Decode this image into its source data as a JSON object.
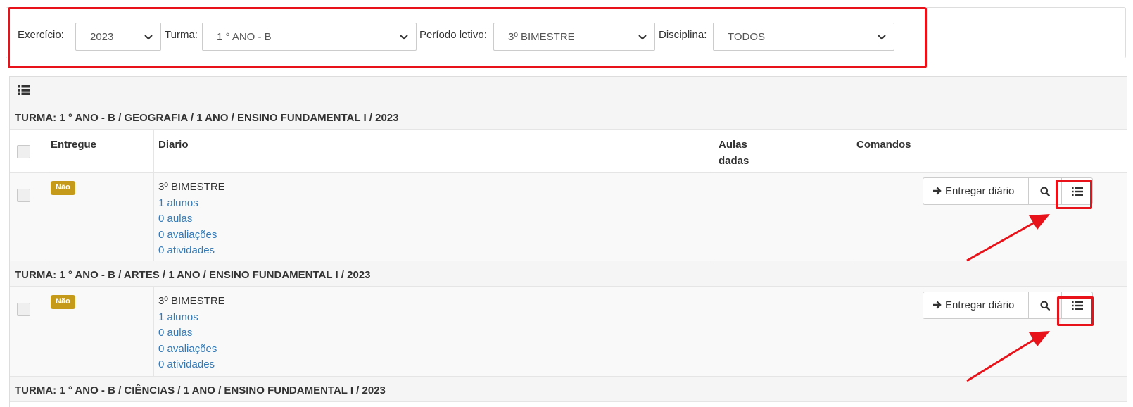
{
  "filters": {
    "exercicio": {
      "label": "Exercício:",
      "value": "2023"
    },
    "turma": {
      "label": "Turma:",
      "value": "1 ° ANO - B"
    },
    "periodo": {
      "label": "Período letivo:",
      "value": "3º BIMESTRE"
    },
    "disciplina": {
      "label": "Disciplina:",
      "value": "TODOS"
    }
  },
  "table": {
    "headers": {
      "entregue": "Entregue",
      "diario": "Diario",
      "aulas_line1": "Aulas",
      "aulas_line2": "dadas",
      "comandos": "Comandos"
    },
    "groups": [
      {
        "title": "TURMA: 1 ° ANO - B / GEOGRAFIA / 1 ANO / ENSINO FUNDAMENTAL I / 2023",
        "row": {
          "status": "Não",
          "periodo": "3º BIMESTRE",
          "alunos": "1 alunos",
          "aulas": "0 aulas",
          "avaliacoes": "0 avaliações",
          "atividades": "0 atividades",
          "entregar_label": "Entregar diário"
        }
      },
      {
        "title": "TURMA: 1 ° ANO - B / ARTES / 1 ANO / ENSINO FUNDAMENTAL I / 2023",
        "row": {
          "status": "Não",
          "periodo": "3º BIMESTRE",
          "alunos": "1 alunos",
          "aulas": "0 aulas",
          "avaliacoes": "0 avaliações",
          "atividades": "0 atividades",
          "entregar_label": "Entregar diário"
        }
      },
      {
        "title": "TURMA: 1 ° ANO - B / CIÊNCIAS / 1 ANO / ENSINO FUNDAMENTAL I / 2023"
      }
    ]
  },
  "colors": {
    "highlight": "#e8131a",
    "badge": "#c59a1b",
    "link": "#337ab7"
  },
  "icons": {
    "panel": "list-icon",
    "select": "chevron-down-icon",
    "entregar": "arrow-right-icon",
    "search": "search-icon",
    "menu": "list-icon"
  }
}
